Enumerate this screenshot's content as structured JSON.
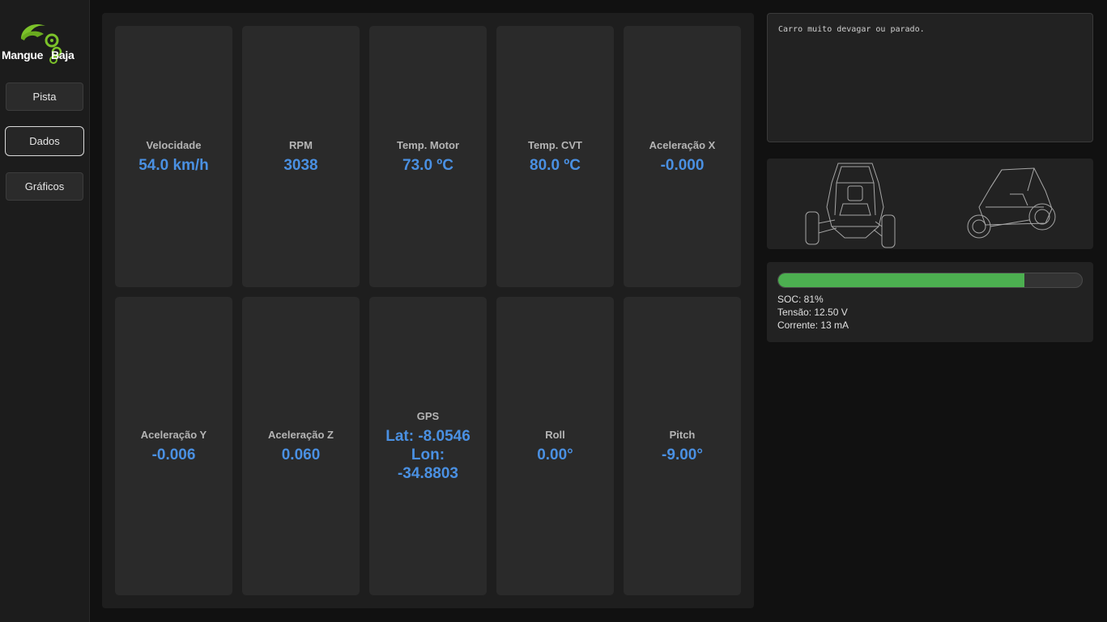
{
  "sidebar": {
    "logo": {
      "left_text": "Mangue",
      "right_text": "Baja"
    },
    "nav": [
      {
        "label": "Pista"
      },
      {
        "label": "Dados"
      },
      {
        "label": "Gráficos"
      }
    ]
  },
  "sensors": [
    {
      "label": "Velocidade",
      "value": "54.0 km/h"
    },
    {
      "label": "RPM",
      "value": "3038"
    },
    {
      "label": "Temp. Motor",
      "value": "73.0 ºC"
    },
    {
      "label": "Temp. CVT",
      "value": "80.0 ºC"
    },
    {
      "label": "Aceleração X",
      "value": "-0.000"
    },
    {
      "label": "Aceleração Y",
      "value": "-0.006"
    },
    {
      "label": "Aceleração Z",
      "value": "0.060"
    },
    {
      "label": "GPS",
      "value_lat": "Lat: -8.0546",
      "value_lon_label": "Lon:",
      "value_lon": "-34.8803"
    },
    {
      "label": "Roll",
      "value": "0.00°"
    },
    {
      "label": "Pitch",
      "value": "-9.00°"
    }
  ],
  "log": {
    "message": "Carro muito devagar ou parado."
  },
  "battery": {
    "soc_percent": 81,
    "soc_text": "SOC: 81%",
    "voltage_text": "Tensão: 12.50 V",
    "current_text": "Corrente: 13 mA",
    "bar_color": "#4caf50"
  },
  "colors": {
    "accent": "#4a90e2",
    "logo_green": "#7cc22a"
  }
}
